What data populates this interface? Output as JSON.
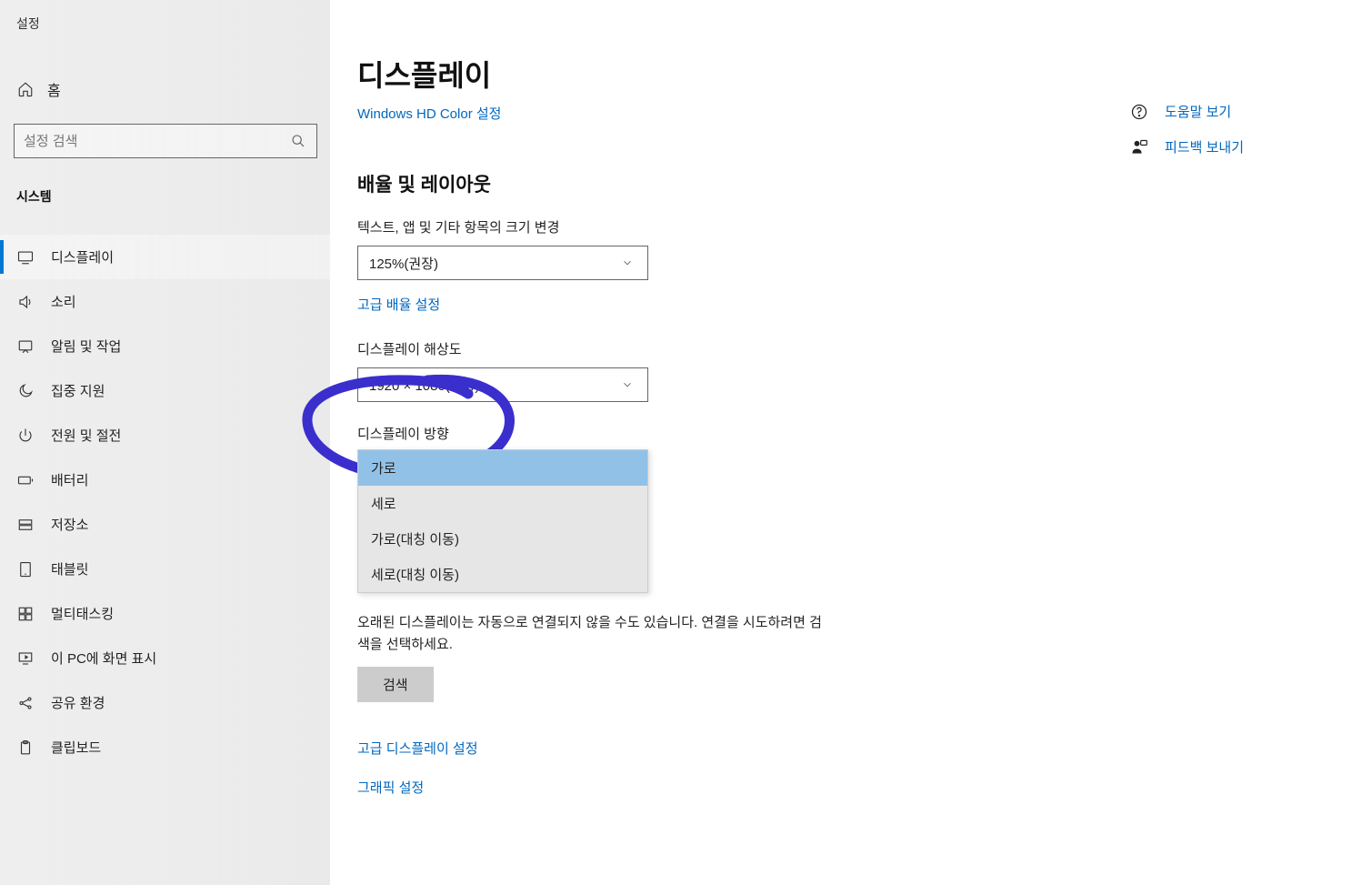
{
  "window": {
    "title": "설정"
  },
  "sidebar": {
    "home": "홈",
    "search_placeholder": "설정 검색",
    "category": "시스템",
    "items": [
      {
        "label": "디스플레이",
        "icon": "display"
      },
      {
        "label": "소리",
        "icon": "sound"
      },
      {
        "label": "알림 및 작업",
        "icon": "notification"
      },
      {
        "label": "집중 지원",
        "icon": "moon"
      },
      {
        "label": "전원 및 절전",
        "icon": "power"
      },
      {
        "label": "배터리",
        "icon": "battery"
      },
      {
        "label": "저장소",
        "icon": "storage"
      },
      {
        "label": "태블릿",
        "icon": "tablet"
      },
      {
        "label": "멀티태스킹",
        "icon": "multitask"
      },
      {
        "label": "이 PC에 화면 표시",
        "icon": "project"
      },
      {
        "label": "공유 환경",
        "icon": "share"
      },
      {
        "label": "클립보드",
        "icon": "clipboard"
      }
    ]
  },
  "main": {
    "title": "디스플레이",
    "hd_color_link": "Windows HD Color 설정",
    "section_title": "배율 및 레이아웃",
    "scale_label": "텍스트, 앱 및 기타 항목의 크기 변경",
    "scale_value": "125%(권장)",
    "advanced_scale_link": "고급 배율 설정",
    "resolution_label": "디스플레이 해상도",
    "resolution_value": "1920 × 1080(권장)",
    "orientation_label": "디스플레이 방향",
    "orientation_options": [
      "가로",
      "세로",
      "가로(대칭 이동)",
      "세로(대칭 이동)"
    ],
    "old_display_text": "오래된 디스플레이는 자동으로 연결되지 않을 수도 있습니다. 연결을 시도하려면 검색을 선택하세요.",
    "search_button": "검색",
    "advanced_display_link": "고급 디스플레이 설정",
    "graphics_link": "그래픽 설정"
  },
  "right": {
    "help": "도움말 보기",
    "feedback": "피드백 보내기"
  }
}
